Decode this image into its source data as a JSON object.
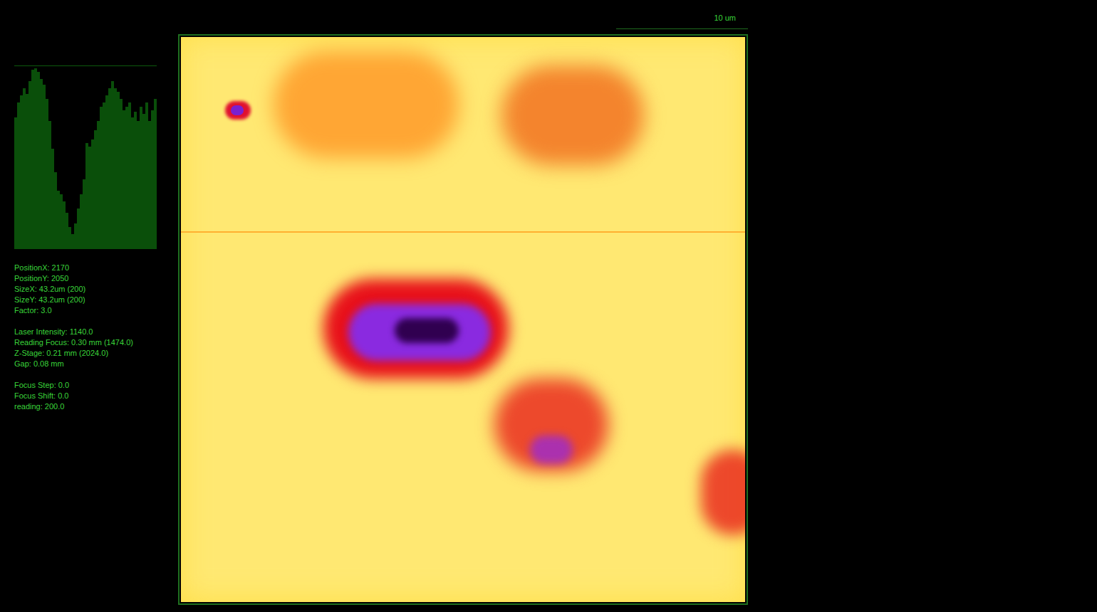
{
  "scale_bar": {
    "label": "10 um"
  },
  "histogram": {
    "values": [
      72,
      80,
      84,
      88,
      85,
      92,
      98,
      99,
      97,
      93,
      90,
      82,
      70,
      55,
      42,
      32,
      30,
      26,
      20,
      12,
      8,
      14,
      22,
      30,
      38,
      58,
      56,
      60,
      65,
      70,
      78,
      80,
      84,
      88,
      92,
      88,
      86,
      82,
      76,
      78,
      80,
      72,
      75,
      70,
      78,
      74,
      80,
      70,
      76,
      82
    ]
  },
  "info_groups": [
    [
      "PositionX: 2170",
      "PositionY: 2050",
      "SizeX: 43.2um (200)",
      "SizeY: 43.2um (200)",
      "Factor: 3.0"
    ],
    [
      "Laser Intensity: 1140.0",
      "Reading Focus: 0.30 mm (1474.0)",
      "Z-Stage: 0.21 mm (2024.0)",
      "Gap: 0.08 mm"
    ],
    [
      "Focus Step: 0.0",
      "Focus Shift: 0.0",
      "reading: 200.0"
    ]
  ]
}
